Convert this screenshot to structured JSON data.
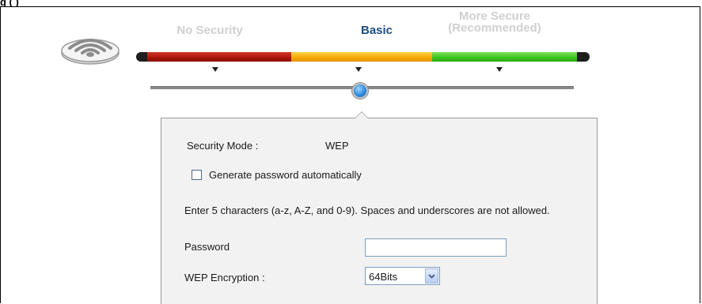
{
  "figure": {
    "title_fragment": "g                                              (        )"
  },
  "security_levels": {
    "no_security": "No Security",
    "basic": "Basic",
    "more_secure_line1": "More Secure",
    "more_secure_line2": "(Recommended)",
    "selected": "Basic"
  },
  "icons": {
    "wifi": "wifi-router-icon",
    "dropdown": "chevron-down-icon"
  },
  "colors": {
    "selected_level": "#1d4e83",
    "inactive_level": "#d0d0d0",
    "bar_red": "#a81508",
    "bar_yellow": "#f4a700",
    "bar_green": "#3cc21e"
  },
  "panel": {
    "security_mode_label": "Security Mode :",
    "security_mode_value": "WEP",
    "generate_password_label": "Generate password automatically",
    "generate_password_checked": false,
    "instructions": "Enter 5 characters (a-z, A-Z, and 0-9). Spaces and underscores are not allowed.",
    "password_label": "Password",
    "password_value": "",
    "wep_encryption_label": "WEP Encryption :",
    "wep_encryption_value": "64Bits"
  }
}
